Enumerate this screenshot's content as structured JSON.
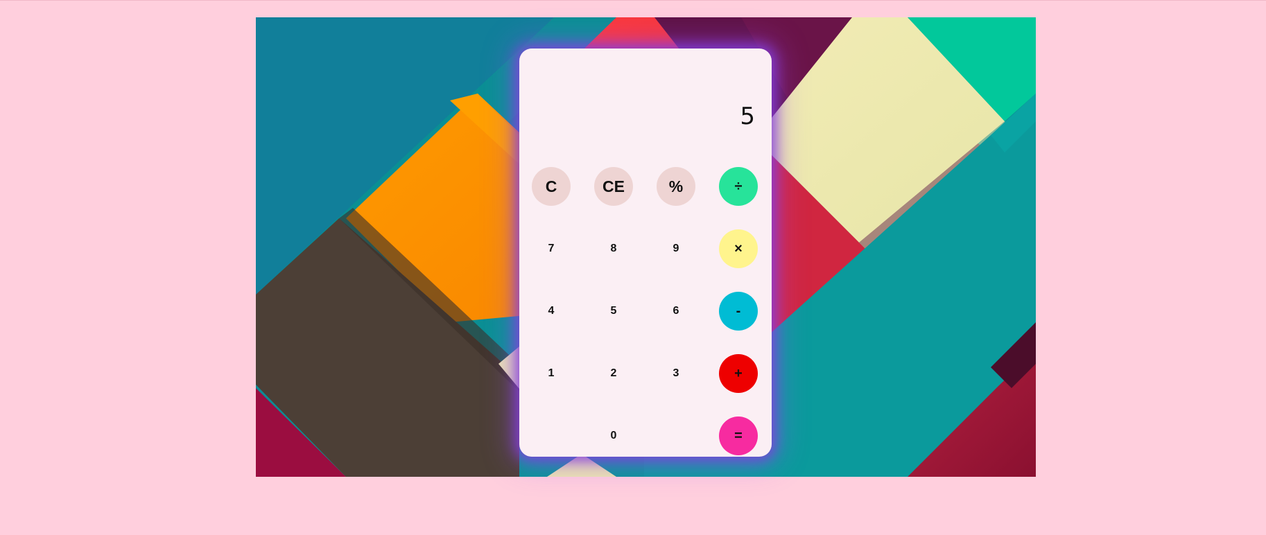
{
  "calculator": {
    "display_value": "5",
    "keys": {
      "clear": "C",
      "clear_entry": "CE",
      "percent": "%",
      "divide": "÷",
      "seven": "7",
      "eight": "8",
      "nine": "9",
      "multiply": "×",
      "four": "4",
      "five": "5",
      "six": "6",
      "subtract": "-",
      "one": "1",
      "two": "2",
      "three": "3",
      "add": "+",
      "zero": "0",
      "equals": "="
    },
    "colors": {
      "function_key": "#eed4d3",
      "divide": "#27e39a",
      "multiply": "#fff48d",
      "subtract": "#00bcd4",
      "add": "#ee0000",
      "equals": "#f72ba0",
      "panel": "#fbeff4",
      "glow": "#8a3cdc"
    }
  },
  "background": {
    "page_color": "#ffcfdd",
    "wallpaper": "material geometric abstract wallpaper"
  }
}
